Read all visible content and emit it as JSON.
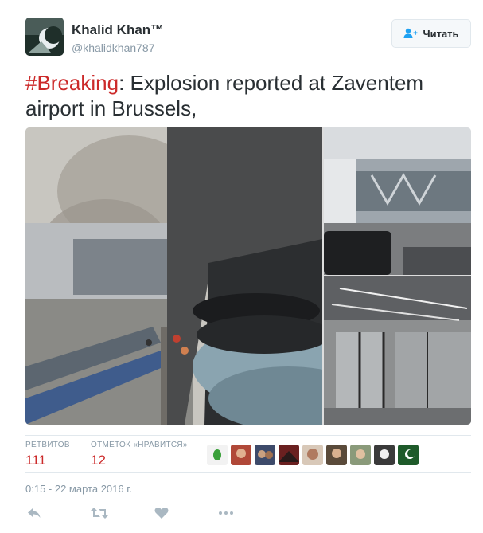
{
  "user": {
    "name": "Khalid Khan™",
    "handle": "@khalidkhan787",
    "follow_label": "Читать"
  },
  "tweet": {
    "hashtag": "#Breaking",
    "text": ": Explosion reported at Zaventem airport in Brussels,"
  },
  "stats": {
    "retweets_label": "РЕТВИТОВ",
    "retweets_value": "111",
    "likes_label": "ОТМЕТОК «НРАВИТСЯ»",
    "likes_value": "12"
  },
  "timestamp": "0:15 - 22 марта 2016 г.",
  "icons": {
    "reply": "reply-icon",
    "retweet": "retweet-icon",
    "like": "heart-icon",
    "more": "more-icon",
    "follow": "add-user-icon"
  },
  "colors": {
    "hashtag": "#cc2a2a",
    "counts": "#cc2a2a",
    "muted": "#8899a6"
  }
}
